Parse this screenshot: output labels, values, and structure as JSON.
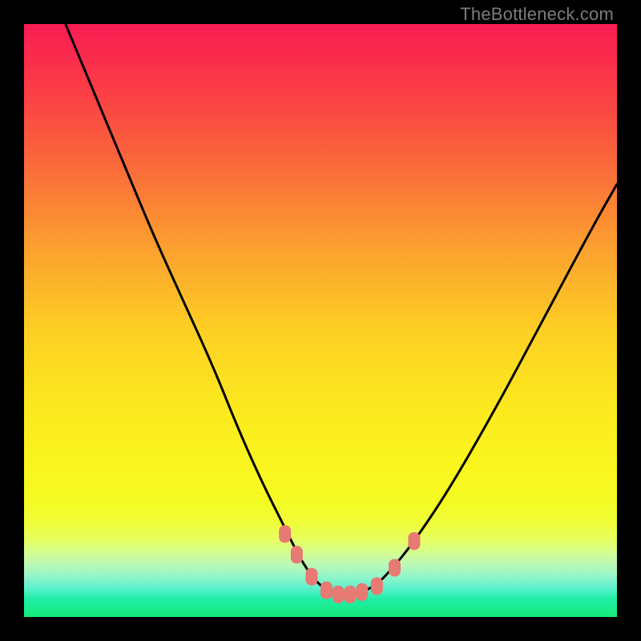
{
  "attribution": "TheBottleneck.com",
  "chart_data": {
    "type": "line",
    "title": "",
    "xlabel": "",
    "ylabel": "",
    "xlim": [
      0,
      100
    ],
    "ylim": [
      0,
      100
    ],
    "grid": false,
    "series": [
      {
        "name": "bottleneck-curve",
        "x": [
          7,
          12,
          17,
          22,
          27,
          32,
          36,
          40,
          44,
          47,
          50,
          53,
          56,
          59,
          62,
          66,
          72,
          80,
          88,
          96,
          100
        ],
        "values": [
          100,
          88,
          76,
          64,
          53,
          42,
          32,
          23,
          15,
          9,
          5,
          4,
          4,
          5,
          8,
          13,
          22,
          36,
          51,
          66,
          73
        ]
      }
    ],
    "markers": {
      "name": "bottleneck-markers",
      "color": "#E77A72",
      "x": [
        44.0,
        46.0,
        48.5,
        51.0,
        53.0,
        55.0,
        57.0,
        59.5,
        62.5,
        65.8
      ],
      "values": [
        14.0,
        10.5,
        6.8,
        4.5,
        3.8,
        3.8,
        4.2,
        5.2,
        8.3,
        12.8
      ]
    },
    "background_gradient": {
      "top": "#F91C53",
      "bottom": "#14EC79"
    }
  }
}
